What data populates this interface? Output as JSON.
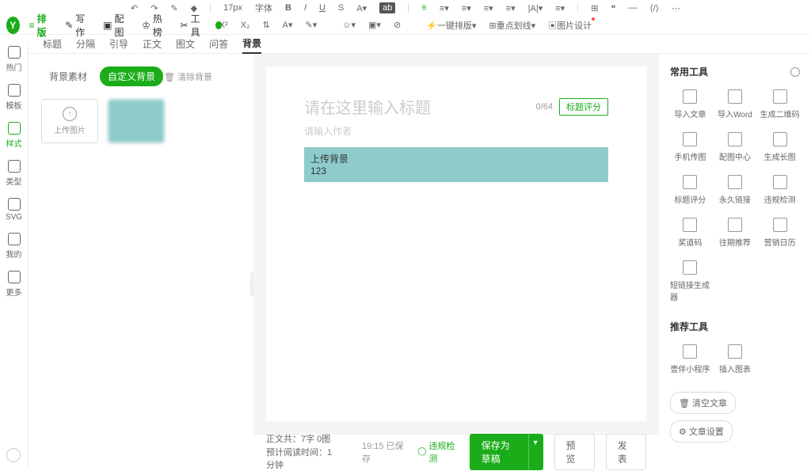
{
  "topToolbar": {
    "fontSize": "17px",
    "fontFamily": "字体",
    "items": [
      "B",
      "I",
      "U",
      "S",
      "A"
    ],
    "moreItems": [
      "左对齐",
      "居中",
      "右对齐",
      "两端",
      "行高",
      "缩进",
      "字间距",
      "段落"
    ]
  },
  "subToolbar": {
    "sup": "X²",
    "sub": "X₂",
    "oneKeyFormat": "一键排版",
    "focusDash": "重点划线",
    "imageDesign": "图片设计"
  },
  "mainNav": {
    "logo": "Y",
    "items": [
      {
        "label": "排版",
        "icon": "≡"
      },
      {
        "label": "写作",
        "icon": "✎"
      },
      {
        "label": "配图",
        "icon": "▣"
      },
      {
        "label": "热榜",
        "icon": "♔"
      },
      {
        "label": "工具",
        "icon": "✂"
      }
    ]
  },
  "leftRail": {
    "items": [
      {
        "label": "热门"
      },
      {
        "label": "模板"
      },
      {
        "label": "样式"
      },
      {
        "label": "类型"
      },
      {
        "label": "SVG"
      },
      {
        "label": "我的"
      },
      {
        "label": "更多"
      }
    ]
  },
  "tabs": [
    "标题",
    "分隔",
    "引导",
    "正文",
    "图文",
    "问答",
    "背景"
  ],
  "panel": {
    "tab1": "背景素材",
    "tab2": "自定义背景",
    "clearBg": "清除背景",
    "upload": "上传图片"
  },
  "editor": {
    "titlePlaceholder": "请在这里输入标题",
    "titleCount": "0/64",
    "titleScore": "标题评分",
    "authorPlaceholder": "请输入作者",
    "contentLine1": "上传背景",
    "contentLine2": "123"
  },
  "footer": {
    "wordCount": "正文共：7字 0图",
    "readTime": "预计阅读时间：1分钟",
    "saveTime": "19:15 已保存",
    "violation": "违规检测",
    "saveDraft": "保存为草稿",
    "preview": "预览",
    "publish": "发表"
  },
  "rightPanel": {
    "commonTools": "常用工具",
    "tools": [
      {
        "label": "导入文章"
      },
      {
        "label": "导入Word"
      },
      {
        "label": "生成二维码"
      },
      {
        "label": "手机传图"
      },
      {
        "label": "配图中心"
      },
      {
        "label": "生成长图"
      },
      {
        "label": "标题评分"
      },
      {
        "label": "永久链接"
      },
      {
        "label": "违规检测"
      },
      {
        "label": "奖道码"
      },
      {
        "label": "往期推荐"
      },
      {
        "label": "营销日历"
      },
      {
        "label": "短链接生成器"
      }
    ],
    "recommendTools": "推荐工具",
    "recTools": [
      {
        "label": "壹伴小程序"
      },
      {
        "label": "插入图表"
      }
    ],
    "clearArticle": "清空文章",
    "articleSettings": "文章设置"
  }
}
